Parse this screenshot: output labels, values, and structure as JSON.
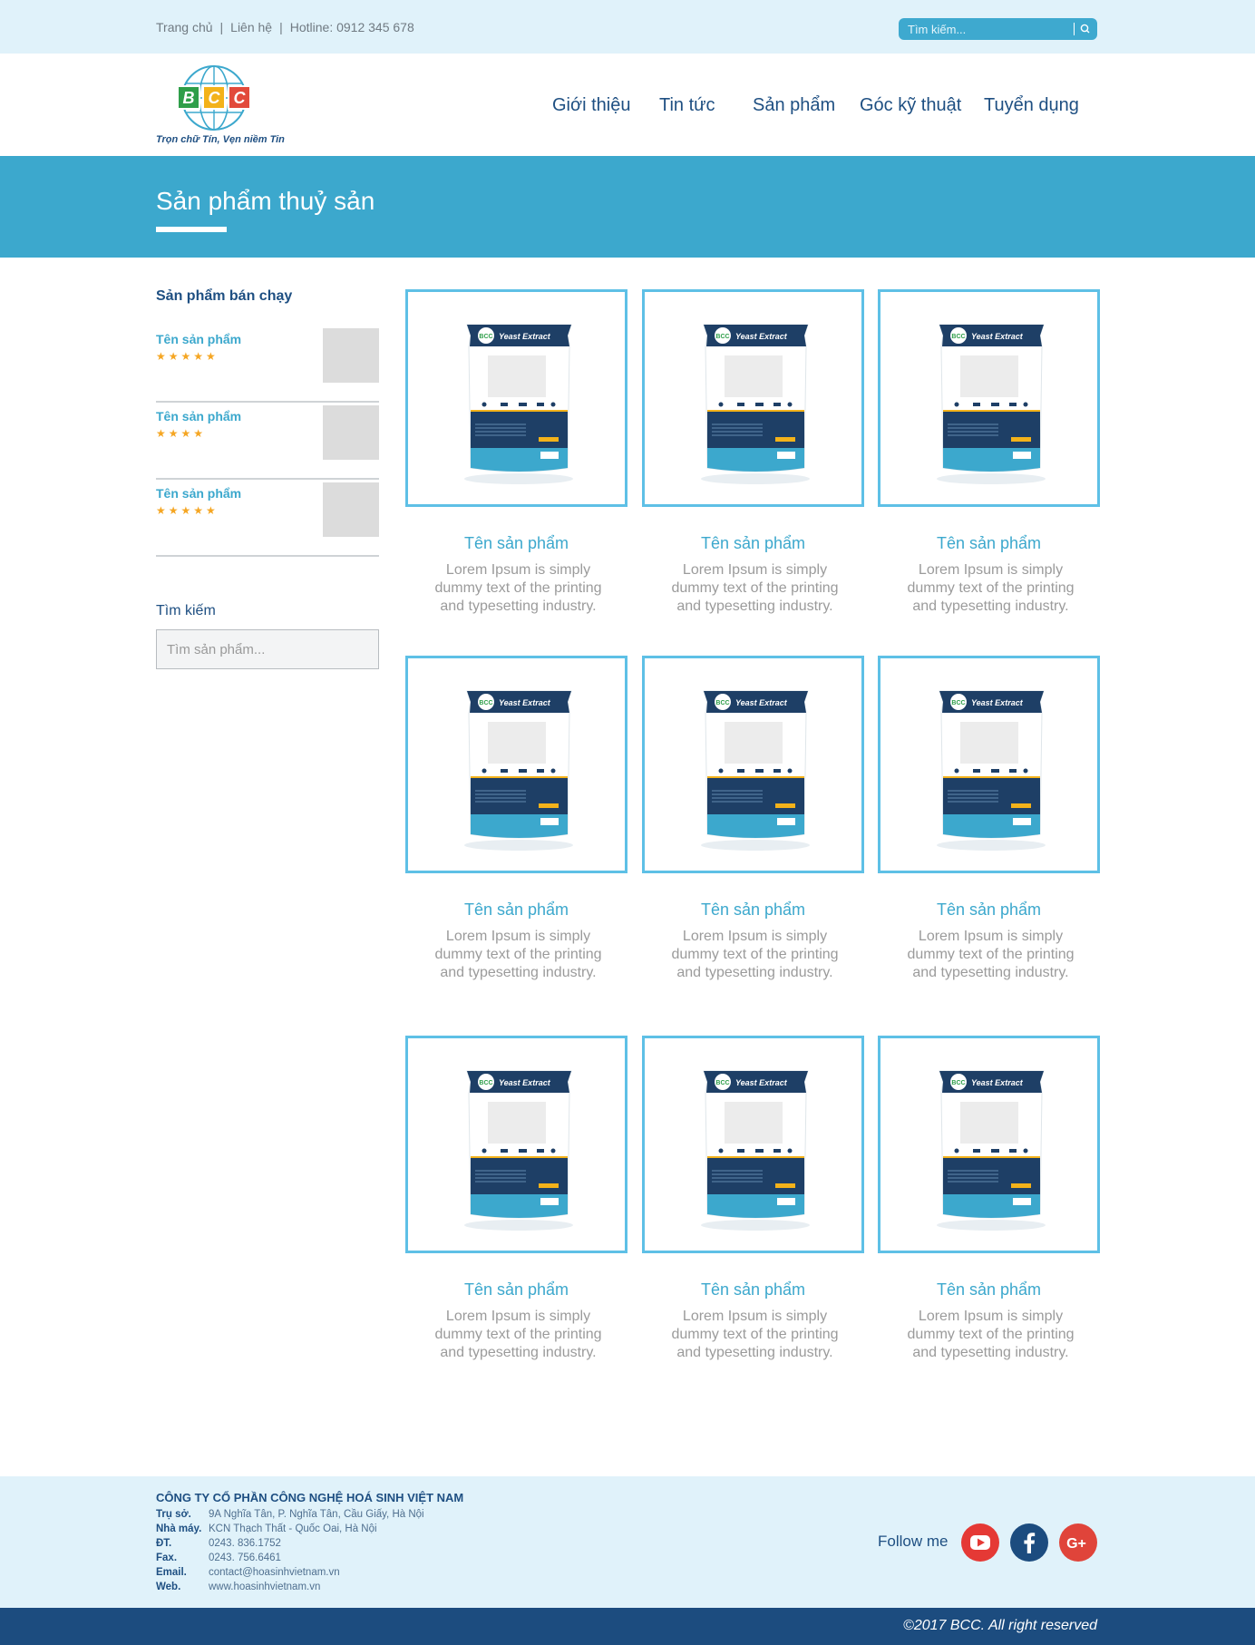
{
  "topbar": {
    "links": [
      "Trang chủ",
      "Liên hệ",
      "Hotline: 0912 345 678"
    ],
    "separator": "|",
    "search_placeholder": "Tìm kiếm..."
  },
  "header": {
    "logo_text": "BCC",
    "slogan": "Trọn chữ Tín, Vẹn niềm Tin",
    "nav": [
      "Giới thiệu",
      "Tin tức",
      "Sản phẩm",
      "Góc kỹ thuật",
      "Tuyển dụng"
    ]
  },
  "banner": {
    "title": "Sản phẩm thuỷ sản"
  },
  "sidebar": {
    "title": "Sản phẩm bán chạy",
    "items": [
      {
        "name": "Tên sản phẩm",
        "rating": 5,
        "stars": "★★★★★"
      },
      {
        "name": "Tên sản phẩm",
        "rating": 4,
        "stars": "★★★★"
      },
      {
        "name": "Tên sản phẩm",
        "rating": 5,
        "stars": "★★★★★"
      }
    ],
    "search_label": "Tìm kiếm",
    "search_placeholder": "Tìm sản phẩm..."
  },
  "product_package": {
    "brand": "BCC",
    "label": "Yeast Extract"
  },
  "products": [
    {
      "name": "Tên sản phẩm",
      "desc": "Lorem Ipsum is simply dummy text of the printing and typesetting industry."
    },
    {
      "name": "Tên sản phẩm",
      "desc": "Lorem Ipsum is simply dummy text of the printing and typesetting industry."
    },
    {
      "name": "Tên sản phẩm",
      "desc": "Lorem Ipsum is simply dummy text of the printing and typesetting industry."
    },
    {
      "name": "Tên sản phẩm",
      "desc": "Lorem Ipsum is simply dummy text of the printing and typesetting industry."
    },
    {
      "name": "Tên sản phẩm",
      "desc": "Lorem Ipsum is simply dummy text of the printing and typesetting industry."
    },
    {
      "name": "Tên sản phẩm",
      "desc": "Lorem Ipsum is simply dummy text of the printing and typesetting industry."
    },
    {
      "name": "Tên sản phẩm",
      "desc": "Lorem Ipsum is simply dummy text of the printing and typesetting industry."
    },
    {
      "name": "Tên sản phẩm",
      "desc": "Lorem Ipsum is simply dummy text of the printing and typesetting industry."
    },
    {
      "name": "Tên sản phẩm",
      "desc": "Lorem Ipsum is simply dummy text of the printing and typesetting industry."
    }
  ],
  "footer": {
    "company": "CÔNG TY CỔ PHẦN CÔNG NGHỆ HOÁ SINH VIỆT NAM",
    "rows": [
      {
        "key": "Trụ sở.",
        "value": "9A Nghĩa Tân, P. Nghĩa Tân, Cầu Giấy, Hà Nội"
      },
      {
        "key": "Nhà máy.",
        "value": "KCN Thạch Thất - Quốc Oai, Hà Nội"
      },
      {
        "key": "ĐT.",
        "value": "0243. 836.1752"
      },
      {
        "key": "Fax.",
        "value": "0243. 756.6461"
      },
      {
        "key": "Email.",
        "value": "contact@hoasinhvietnam.vn"
      },
      {
        "key": "Web.",
        "value": "www.hoasinhvietnam.vn"
      }
    ],
    "follow_label": "Follow me",
    "social": [
      {
        "icon": "youtube-icon",
        "color": "#e53935"
      },
      {
        "icon": "facebook-icon",
        "color": "#1c4c7f"
      },
      {
        "icon": "google-plus-icon",
        "color": "#e0443a"
      }
    ],
    "copyright": "©2017 BCC. All right reserved"
  },
  "colors": {
    "accent": "#3ca8cd",
    "navy": "#1e4f82",
    "frame": "#5ec0e6",
    "light_bg": "#e0f2fa",
    "star": "#f5a623"
  }
}
